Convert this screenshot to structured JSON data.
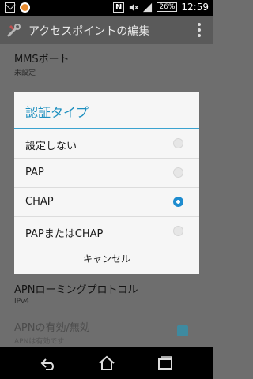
{
  "status_bar": {
    "nfc": "N",
    "battery": "26%",
    "time": "12:59"
  },
  "app_bar": {
    "title": "アクセスポイントの編集"
  },
  "background": {
    "items": [
      {
        "title": "MMSポート",
        "subtitle": "未設定"
      },
      {
        "title": "APNローミングプロトコル",
        "subtitle": "IPv4"
      },
      {
        "title": "APNの有効/無効",
        "subtitle": "APNは有効です"
      }
    ]
  },
  "dialog": {
    "title": "認証タイプ",
    "options": [
      {
        "label": "設定しない",
        "selected": false
      },
      {
        "label": "PAP",
        "selected": false
      },
      {
        "label": "CHAP",
        "selected": true
      },
      {
        "label": "PAPまたはCHAP",
        "selected": false
      }
    ],
    "cancel_label": "キャンセル"
  },
  "colors": {
    "accent": "#1d8fbf",
    "radio_selected": "#1e8ccf"
  }
}
